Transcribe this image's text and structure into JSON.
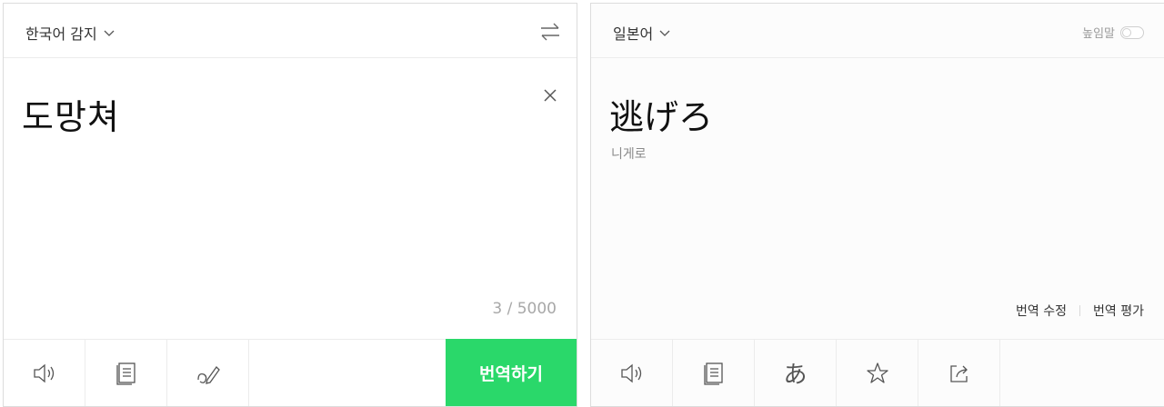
{
  "source": {
    "language_label": "한국어 감지",
    "text": "도망쳐",
    "char_count": "3 / 5000",
    "translate_button": "번역하기"
  },
  "target": {
    "language_label": "일본어",
    "honorific_label": "높임말",
    "honorific_on": false,
    "text": "逃げろ",
    "pronunciation": "니게로",
    "edit_translation": "번역 수정",
    "rate_translation": "번역 평가"
  },
  "icons": {
    "source_toolbar": [
      "speaker-icon",
      "dictionary-icon",
      "handwriting-icon"
    ],
    "target_toolbar": [
      "speaker-icon",
      "dictionary-icon",
      "kana-icon",
      "star-icon",
      "share-icon"
    ],
    "kana_glyph": "あ"
  },
  "colors": {
    "accent": "#2ad86a"
  }
}
